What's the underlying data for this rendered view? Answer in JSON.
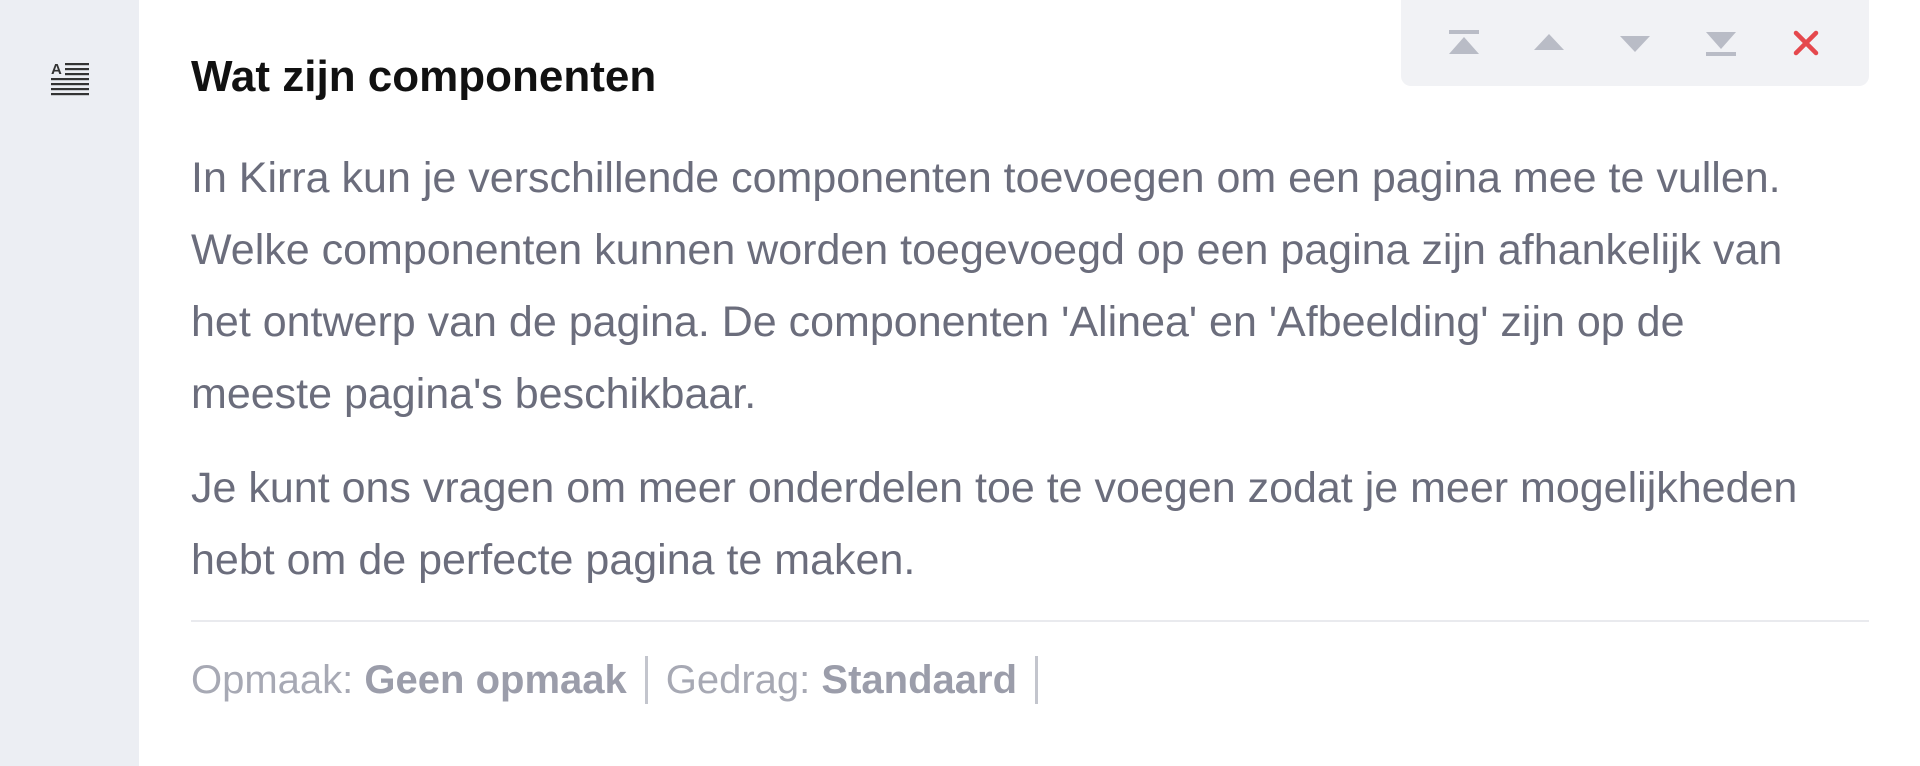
{
  "block": {
    "type_icon": "paragraph-align-icon",
    "title": "Wat zijn componenten",
    "paragraphs": [
      "In Kirra kun je verschillende componenten toevoegen om een pagina mee te vullen. Welke componenten kunnen worden toegevoegd op een pagina zijn afhankelijk van het ontwerp van de pagina. De componenten 'Alinea' en 'Afbeelding' zijn op de meeste pagina's beschikbaar.",
      "Je kunt ons vragen om meer onderdelen toe te voegen zodat je meer mogelijkheden hebt om de perfecte pagina te maken."
    ],
    "meta": {
      "layout_label": "Opmaak:",
      "layout_value": "Geen opmaak",
      "behavior_label": "Gedrag:",
      "behavior_value": "Standaard"
    }
  },
  "toolbar": {
    "buttons": [
      {
        "name": "move-to-top-icon"
      },
      {
        "name": "move-up-icon"
      },
      {
        "name": "move-down-icon"
      },
      {
        "name": "move-to-bottom-icon"
      },
      {
        "name": "close-icon"
      }
    ]
  },
  "colors": {
    "icon_grey": "#b9bcc6",
    "delete_red": "#e5484d",
    "gutter_bg": "#eceef3",
    "text_grey": "#6b6d7c"
  }
}
